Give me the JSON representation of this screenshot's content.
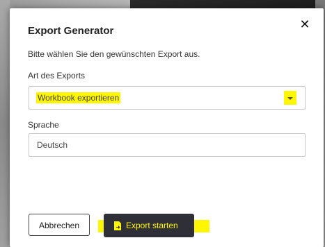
{
  "dialog": {
    "title": "Export Generator",
    "close_icon": "close-icon",
    "instruction": "Bitte wählen Sie den gewünschten Export aus.",
    "export_type": {
      "label": "Art des Exports",
      "value": "Workbook exportieren",
      "dropdown_icon": "chevron-down-icon"
    },
    "language": {
      "label": "Sprache",
      "value": "Deutsch"
    },
    "buttons": {
      "cancel": "Abbrechen",
      "export": "Export starten",
      "export_icon": "file-export-icon"
    }
  },
  "colors": {
    "highlight": "#fff600",
    "primary_button": "#2f3037",
    "dialog_background": "#ffffff"
  }
}
